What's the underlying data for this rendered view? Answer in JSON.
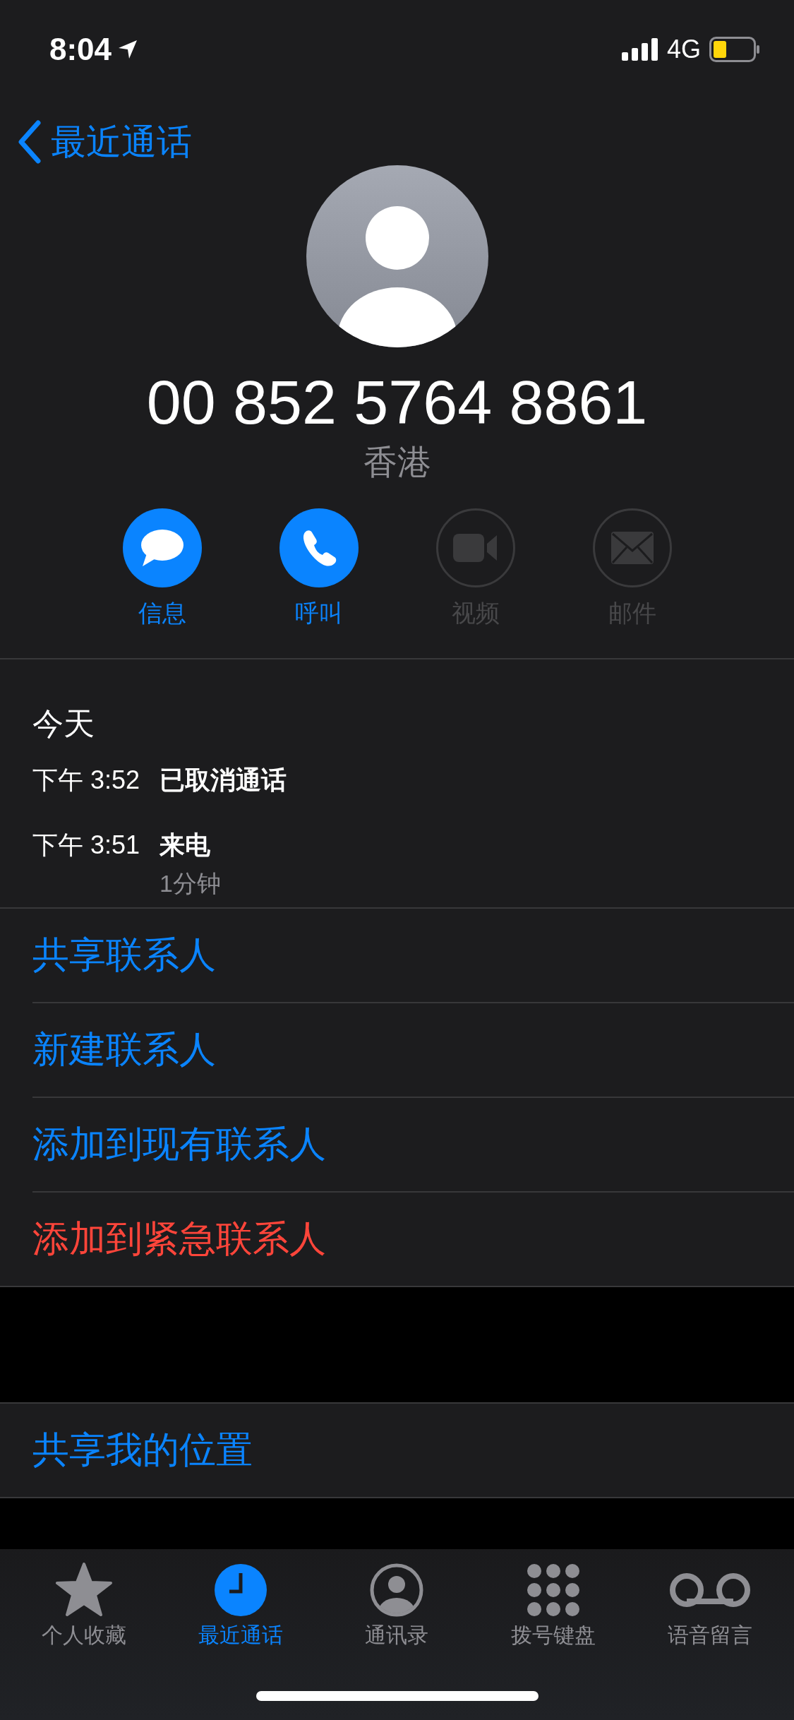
{
  "status_bar": {
    "time": "8:04",
    "network": "4G"
  },
  "nav": {
    "back_label": "最近通话"
  },
  "contact": {
    "number": "00 852 5764 8861",
    "location": "香港"
  },
  "actions": [
    {
      "kind": "message",
      "label": "信息",
      "disabled": false
    },
    {
      "kind": "call",
      "label": "呼叫",
      "disabled": false
    },
    {
      "kind": "video",
      "label": "视频",
      "disabled": true
    },
    {
      "kind": "mail",
      "label": "邮件",
      "disabled": true
    }
  ],
  "calls": {
    "heading": "今天",
    "entries": [
      {
        "time": "下午 3:52",
        "type": "已取消通话"
      },
      {
        "time": "下午 3:51",
        "type": "来电",
        "duration": "1分钟"
      }
    ]
  },
  "options": [
    {
      "label": "共享联系人",
      "destructive": false
    },
    {
      "label": "新建联系人",
      "destructive": false
    },
    {
      "label": "添加到现有联系人",
      "destructive": false
    },
    {
      "label": "添加到紧急联系人",
      "destructive": true
    }
  ],
  "location_option": {
    "label": "共享我的位置"
  },
  "tabs": [
    {
      "kind": "favorites",
      "label": "个人收藏",
      "selected": false
    },
    {
      "kind": "recents",
      "label": "最近通话",
      "selected": true
    },
    {
      "kind": "contacts",
      "label": "通讯录",
      "selected": false
    },
    {
      "kind": "keypad",
      "label": "拨号键盘",
      "selected": false
    },
    {
      "kind": "voicemail",
      "label": "语音留言",
      "selected": false
    }
  ]
}
